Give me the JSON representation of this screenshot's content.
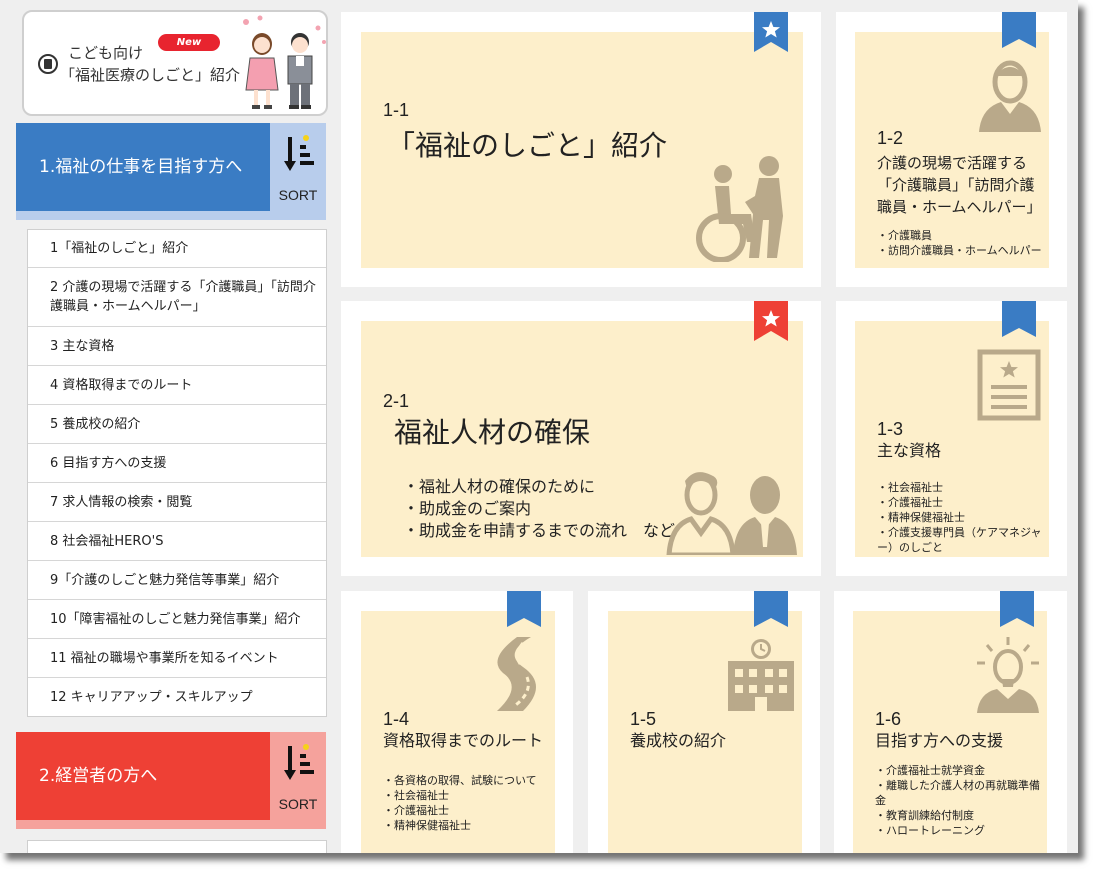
{
  "kids_banner": {
    "line1": "こども向け",
    "line2": "「福祉医療のしごと」紹介",
    "badge": "New"
  },
  "categories": [
    {
      "label": "1.福祉の仕事を目指す方へ",
      "sort_label": "SORT",
      "color": "#3a7cc4",
      "accent": "#b8cdec"
    },
    {
      "label": "2.経営者の方へ",
      "sort_label": "SORT",
      "color": "#ee4035",
      "accent": "#f5a29c"
    }
  ],
  "menu_items": [
    "1「福祉のしごと」紹介",
    "2 介護の現場で活躍する「介護職員」「訪問介護職員・ホームヘルパー」",
    "3 主な資格",
    "4 資格取得までのルート",
    "5 養成校の紹介",
    "6 目指す方への支援",
    "7 求人情報の検索・閲覧",
    "8 社会福祉HERO'S",
    "9「介護のしごと魅力発信等事業」紹介",
    "10「障害福祉のしごと魅力発信事業」紹介",
    "11 福祉の職場や事業所を知るイベント",
    "12 キャリアアップ・スキルアップ"
  ],
  "tiles": {
    "t11": {
      "number": "1-1",
      "title": "「福祉のしごと」紹介",
      "ribbon": "star-blue",
      "icon": "wheelchair-caregiver-icon"
    },
    "t12": {
      "number": "1-2",
      "title": "介護の現場で活躍する「介護職員」「訪問介護職員・ホームヘルパー」",
      "bullets": [
        "介護職員",
        "訪問介護職員・ホームヘルパー"
      ],
      "icon": "person-icon"
    },
    "t21": {
      "number": "2-1",
      "title": "福祉人材の確保",
      "bullets": [
        "福祉人材の確保のために",
        "助成金のご案内",
        "助成金を申請するまでの流れ　など"
      ],
      "ribbon": "star-red",
      "icon": "staff-pair-icon"
    },
    "t13": {
      "number": "1-3",
      "title": "主な資格",
      "bullets": [
        "社会福祉士",
        "介護福祉士",
        "精神保健福祉士",
        "介護支援専門員（ケアマネジャー）のしごと"
      ],
      "icon": "certificate-icon"
    },
    "t14": {
      "number": "1-4",
      "title": "資格取得までのルート",
      "bullets": [
        "各資格の取得、試験について",
        "社会福祉士",
        "介護福祉士",
        "精神保健福祉士"
      ],
      "icon": "road-icon"
    },
    "t15": {
      "number": "1-5",
      "title": "養成校の紹介",
      "icon": "school-icon"
    },
    "t16": {
      "number": "1-6",
      "title": "目指す方への支援",
      "bullets": [
        "介護福祉士就学資金",
        "離職した介護人材の再就職準備金",
        "教育訓練給付制度",
        "ハロートレーニング"
      ],
      "icon": "idea-person-icon"
    }
  },
  "colors": {
    "tile_bg": "#fdefcb",
    "icon": "#b9a98a",
    "ribbon_blue": "#3a7cc4",
    "ribbon_red": "#ee4035"
  }
}
